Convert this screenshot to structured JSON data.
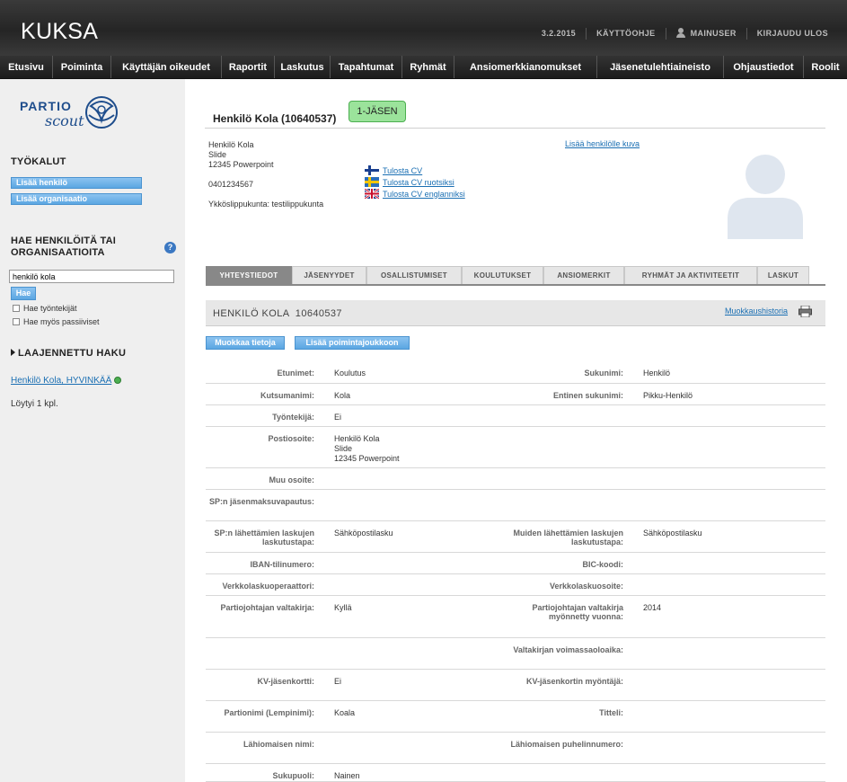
{
  "header": {
    "logo": "KUKSA",
    "date": "3.2.2015",
    "help": "KÄYTTÖOHJE",
    "user": "MAINUSER",
    "logout": "KIRJAUDU ULOS"
  },
  "nav": [
    "Etusivu",
    "Poiminta",
    "Käyttäjän oikeudet",
    "Raportit",
    "Laskutus",
    "Tapahtumat",
    "Ryhmät",
    "Ansiomerkkianomukset",
    "Jäsenetulehtiaineisto",
    "Ohjaustiedot",
    "Roolit"
  ],
  "sidebar": {
    "logo_top": "PARTIO",
    "logo_bottom": "scout",
    "tools_heading": "TYÖKALUT",
    "add_person": "Lisää henkilö",
    "add_org": "Lisää organisaatio",
    "search_heading_1": "HAE HENKILÖITÄ TAI",
    "search_heading_2": "ORGANISAATIOITA",
    "help_icon": "?",
    "search_value": "henkilö kola",
    "search_button": "Hae",
    "check_employees": "Hae työntekijät",
    "check_passive": "Hae myös passiiviset",
    "extended_search": "LAAJENNETTU HAKU",
    "result_link": "Henkilö Kola, HYVINKÄÄ",
    "found": "Löytyi 1 kpl."
  },
  "person": {
    "title": "Henkilö Kola (10640537)",
    "badge": "1-JÄSEN",
    "name": "Henkilö Kola",
    "address_line1": "Slide",
    "address_line2": "12345 Powerpoint",
    "phone": "0401234567",
    "unit": "Ykköslippukunta: testilippukunta",
    "add_photo": "Lisää henkilölle kuva",
    "cv_fi": "Tulosta CV",
    "cv_sv": "Tulosta CV ruotsiksi",
    "cv_en": "Tulosta CV englanniksi"
  },
  "tabs": [
    "YHTEYSTIEDOT",
    "JÄSENYYDET",
    "OSALLISTUMISET",
    "KOULUTUKSET",
    "ANSIOMERKIT",
    "RYHMÄT JA AKTIVITEETIT",
    "LASKUT"
  ],
  "section": {
    "title": "HENKILÖ KOLA  10640537",
    "history": "Muokkaushistoria",
    "edit_button": "Muokkaa tietoja",
    "add_button": "Lisää poimintajoukkoon"
  },
  "details": [
    {
      "l1": "Etunimet:",
      "v1": "Koulutus",
      "l2": "Sukunimi:",
      "v2": "Henkilö"
    },
    {
      "l1": "Kutsumanimi:",
      "v1": "Kola",
      "l2": "Entinen sukunimi:",
      "v2": "Pikku-Henkilö"
    },
    {
      "l1": "Työntekijä:",
      "v1": "Ei",
      "l2": "",
      "v2": ""
    },
    {
      "l1": "Postiosoite:",
      "v1": "Henkilö Kola\nSlide\n12345 Powerpoint",
      "l2": "",
      "v2": ""
    },
    {
      "l1": "Muu osoite:",
      "v1": "",
      "l2": "",
      "v2": ""
    },
    {
      "l1": "SP:n jäsenmaksuvapautus:",
      "v1": "",
      "l2": "",
      "v2": ""
    },
    {
      "l1": "SP:n lähettämien laskujen laskutustapa:",
      "v1": "Sähköpostilasku",
      "l2": "Muiden lähettämien laskujen laskutustapa:",
      "v2": "Sähköpostilasku"
    },
    {
      "l1": "IBAN-tilinumero:",
      "v1": "",
      "l2": "BIC-koodi:",
      "v2": ""
    },
    {
      "l1": "Verkkolaskuoperaattori:",
      "v1": "",
      "l2": "Verkkolaskuosoite:",
      "v2": ""
    },
    {
      "l1": "Partiojohtajan valtakirja:",
      "v1": "Kyllä",
      "l2": "Partiojohtajan valtakirja myönnetty vuonna:",
      "v2": "2014"
    },
    {
      "l1": "",
      "v1": "",
      "l2": "Valtakirjan voimassaoloaika:",
      "v2": ""
    },
    {
      "l1": "KV-jäsenkortti:",
      "v1": "Ei",
      "l2": "KV-jäsenkortin myöntäjä:",
      "v2": ""
    },
    {
      "l1": "Partionimi (Lempinimi):",
      "v1": "Koala",
      "l2": "Titteli:",
      "v2": ""
    },
    {
      "l1": "Lähiomaisen nimi:",
      "v1": "",
      "l2": "Lähiomaisen puhelinnumero:",
      "v2": ""
    },
    {
      "l1": "Sukupuoli:",
      "v1": "Nainen",
      "l2": "",
      "v2": ""
    }
  ]
}
